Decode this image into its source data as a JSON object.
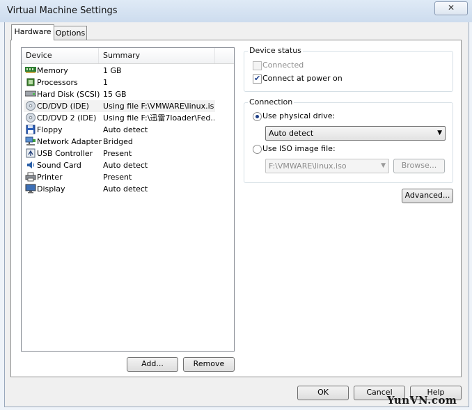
{
  "window": {
    "title": "Virtual Machine Settings",
    "close_glyph": "✕"
  },
  "tabs": [
    {
      "label": "Hardware",
      "active": true
    },
    {
      "label": "Options",
      "active": false
    }
  ],
  "device_list": {
    "columns": {
      "device": "Device",
      "summary": "Summary"
    },
    "rows": [
      {
        "icon": "memory-icon",
        "device": "Memory",
        "summary": "1 GB"
      },
      {
        "icon": "processor-icon",
        "device": "Processors",
        "summary": "1"
      },
      {
        "icon": "hard-disk-icon",
        "device": "Hard Disk (SCSI)",
        "summary": "15 GB"
      },
      {
        "icon": "cd-dvd-icon",
        "device": "CD/DVD (IDE)",
        "summary": "Using file F:\\VMWARE\\linux.iso",
        "selected": true
      },
      {
        "icon": "cd-dvd-icon",
        "device": "CD/DVD 2 (IDE)",
        "summary": "Using file F:\\迅雷7loader\\Fed..."
      },
      {
        "icon": "floppy-icon",
        "device": "Floppy",
        "summary": "Auto detect"
      },
      {
        "icon": "network-adapter-icon",
        "device": "Network Adapter",
        "summary": "Bridged"
      },
      {
        "icon": "usb-icon",
        "device": "USB Controller",
        "summary": "Present"
      },
      {
        "icon": "sound-card-icon",
        "device": "Sound Card",
        "summary": "Auto detect"
      },
      {
        "icon": "printer-icon",
        "device": "Printer",
        "summary": "Present"
      },
      {
        "icon": "display-icon",
        "device": "Display",
        "summary": "Auto detect"
      }
    ],
    "add_label": "Add...",
    "remove_label": "Remove"
  },
  "device_status": {
    "title": "Device status",
    "connected": {
      "label": "Connected",
      "checked": false,
      "enabled": false
    },
    "connect_power_on": {
      "label": "Connect at power on",
      "checked": true
    }
  },
  "connection": {
    "title": "Connection",
    "physical": {
      "label": "Use physical drive:",
      "selected": true,
      "value": "Auto detect"
    },
    "iso": {
      "label": "Use ISO image file:",
      "selected": false,
      "value": "F:\\VMWARE\\linux.iso",
      "browse_label": "Browse..."
    }
  },
  "advanced_label": "Advanced...",
  "footer": {
    "ok": "OK",
    "cancel": "Cancel",
    "help": "Help"
  },
  "watermark": "YunVN.com"
}
